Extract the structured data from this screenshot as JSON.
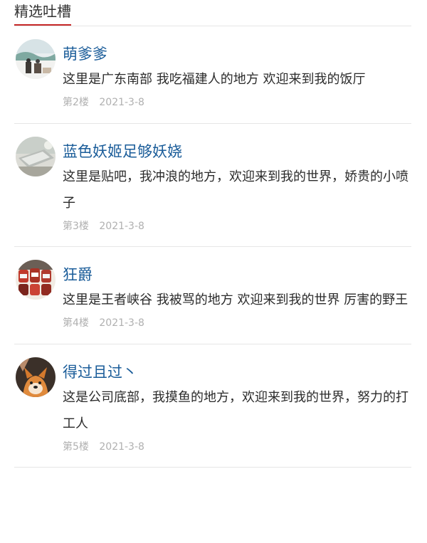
{
  "section": {
    "title": "精选吐槽"
  },
  "comments": [
    {
      "nickname": "萌爹爹",
      "text": "这里是广东南部 我吃福建人的地方 欢迎来到我的饭厅",
      "floor": "第2楼",
      "date": "2021-3-8",
      "avatar_icon": "landscape-avatar"
    },
    {
      "nickname": "蓝色妖姬足够妖娆",
      "text": "这里是贴吧，我冲浪的地方，欢迎来到我的世界，娇贵的小喷子",
      "floor": "第3楼",
      "date": "2021-3-8",
      "avatar_icon": "laptop-avatar"
    },
    {
      "nickname": "狂爵",
      "text": "这里是王者峡谷 我被骂的地方 欢迎来到我的世界 厉害的野王",
      "floor": "第4楼",
      "date": "2021-3-8",
      "avatar_icon": "jars-avatar"
    },
    {
      "nickname": "得过且过丶",
      "text": "这是公司底部，我摸鱼的地方，欢迎来到我的世界，努力的打工人",
      "floor": "第5楼",
      "date": "2021-3-8",
      "avatar_icon": "shiba-dog-avatar"
    }
  ],
  "colors": {
    "accent": "#c62828",
    "nickname": "#1a5c99",
    "meta": "#b0b0b0",
    "divider": "#e6e6e6"
  }
}
